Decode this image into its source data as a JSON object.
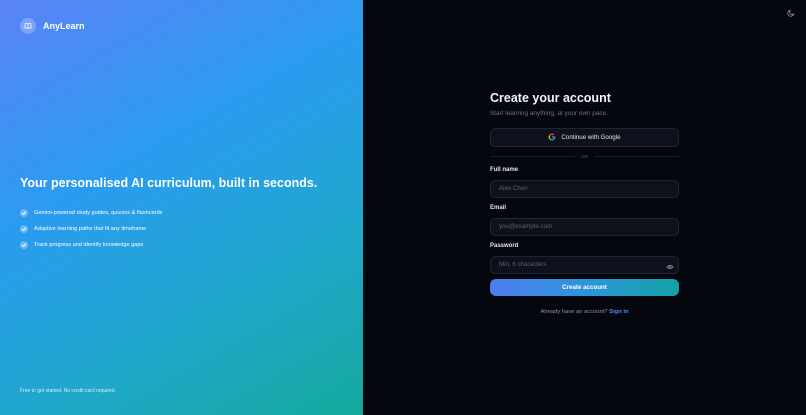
{
  "brand": {
    "name": "AnyLearn",
    "icon": "book-icon"
  },
  "hero": {
    "headline": "Your personalised AI curriculum, built in seconds.",
    "features": [
      "Gemini-powered study guides, quizzes & flashcards",
      "Adaptive learning paths that fit any timeframe",
      "Track progress and identify knowledge gaps"
    ],
    "footnote": "Free to get started. No credit card required."
  },
  "header": {
    "theme_toggle_icon": "moon-icon"
  },
  "form": {
    "title": "Create your account",
    "subtitle": "Start learning anything, at your own pace.",
    "google_label": "Continue with Google",
    "divider": "OR",
    "fields": {
      "name": {
        "label": "Full name",
        "placeholder": "Alex Chen",
        "value": ""
      },
      "email": {
        "label": "Email",
        "placeholder": "you@example.com",
        "value": ""
      },
      "password": {
        "label": "Password",
        "placeholder": "Min. 6 characters",
        "value": ""
      }
    },
    "submit_label": "Create account",
    "signin_prompt": "Already have an account?",
    "signin_link": "Sign in"
  },
  "colors": {
    "accent": "#4d8ef7",
    "gradient_start": "#5b82f6",
    "gradient_end": "#14a89c",
    "panel_bg": "#05070f",
    "input_bg": "#0d111c"
  }
}
